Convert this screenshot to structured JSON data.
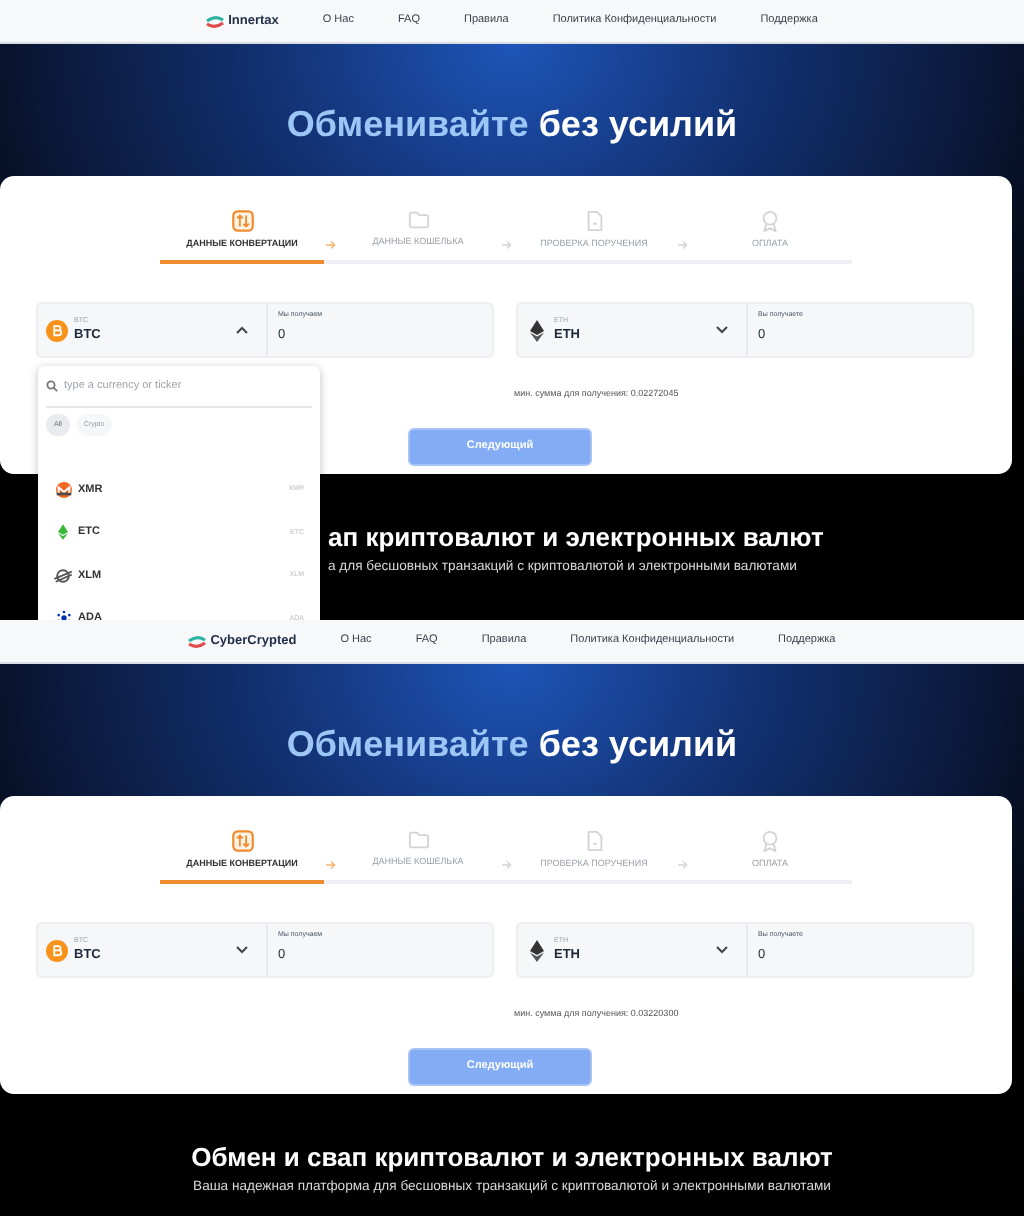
{
  "screens": [
    {
      "nav": {
        "logo": "Innertax",
        "links": [
          "О Нас",
          "FAQ",
          "Правила",
          "Политика Конфиденциальности",
          "Поддержка"
        ]
      },
      "hero": {
        "title_highlight": "Обменивайте",
        "title_rest": "без усилий"
      },
      "steps": [
        {
          "label": "ДАННЫЕ КОНВЕРТАЦИИ",
          "selected": true,
          "kind": "swap"
        },
        {
          "label": "ДАННЫЕ КОШЕЛЬКА",
          "selected": false,
          "kind": "folder"
        },
        {
          "label": "ПРОВЕРКА ПОРУЧЕНИЯ",
          "selected": false,
          "kind": "document"
        },
        {
          "label": "ОПЛАТА",
          "selected": false,
          "kind": "badge"
        }
      ],
      "send": {
        "kind": "btc",
        "currency_label": "BTC",
        "currency": "BTC",
        "expanded": true,
        "amount_label": "Мы получаем",
        "amount": "0"
      },
      "receive": {
        "kind": "eth",
        "currency_label": "ETH",
        "currency": "ETH",
        "expanded": false,
        "amount_label": "Вы получаете",
        "amount": "0"
      },
      "min_note": "мин. сумма для получения: 0.02272045",
      "next_button": {
        "label": "Следующий",
        "disabled": true
      },
      "dropdown": {
        "placeholder": "type a currency or ticker",
        "filters": [
          {
            "label": "All",
            "selected": true
          },
          {
            "label": "Crypto",
            "selected": false
          }
        ],
        "items": [
          {
            "kind": "xmr",
            "name": "XMR",
            "ticker": "XMR"
          },
          {
            "kind": "etc",
            "name": "ETC",
            "ticker": "ETC"
          },
          {
            "kind": "xlm",
            "name": "XLM",
            "ticker": "XLM"
          },
          {
            "kind": "ada",
            "name": "ADA",
            "ticker": "ADA"
          }
        ]
      },
      "footer_heading": "ап криптовалют и электронных валют",
      "footer_subtitle": "а для бесшовных транзакций с криптовалютой и электронными валютами"
    },
    {
      "nav": {
        "logo": "CyberCrypted",
        "links": [
          "О Нас",
          "FAQ",
          "Правила",
          "Политика Конфиденциальности",
          "Поддержка"
        ]
      },
      "hero": {
        "title_highlight": "Обменивайте",
        "title_rest": "без усилий"
      },
      "steps": [
        {
          "label": "ДАННЫЕ КОНВЕРТАЦИИ",
          "selected": true,
          "kind": "swap"
        },
        {
          "label": "ДАННЫЕ КОШЕЛЬКА",
          "selected": false,
          "kind": "folder"
        },
        {
          "label": "ПРОВЕРКА ПОРУЧЕНИЯ",
          "selected": false,
          "kind": "document"
        },
        {
          "label": "ОПЛАТА",
          "selected": false,
          "kind": "badge"
        }
      ],
      "send": {
        "kind": "btc",
        "currency_label": "BTC",
        "currency": "BTC",
        "expanded": false,
        "amount_label": "Мы получаем",
        "amount": "0"
      },
      "receive": {
        "kind": "eth",
        "currency_label": "ETH",
        "currency": "ETH",
        "expanded": false,
        "amount_label": "Вы получаете",
        "amount": "0"
      },
      "min_note": "мин. сумма для получения: 0.03220300",
      "next_button": {
        "label": "Следующий",
        "disabled": true
      },
      "footer_heading": "Обмен и свап криптовалют и электронных валют",
      "footer_subtitle": "Ваша надежная платформа для бесшовных транзакций с криптовалютой и электронными валютами"
    }
  ]
}
